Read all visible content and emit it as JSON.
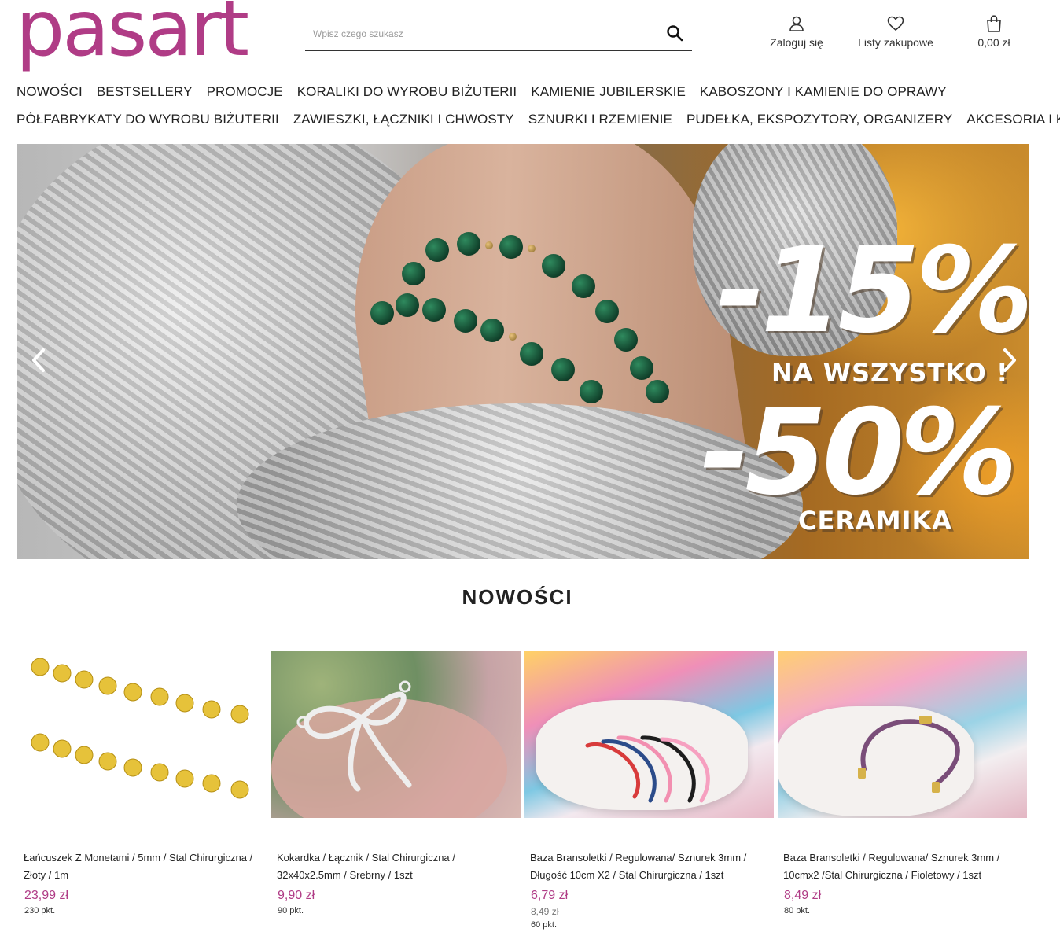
{
  "brand": {
    "logo_text": "pasart",
    "color": "#b03c86"
  },
  "search": {
    "placeholder": "Wpisz czego szukasz",
    "icon": "search-icon"
  },
  "header_actions": {
    "login": {
      "label": "Zaloguj się",
      "icon": "user-icon"
    },
    "lists": {
      "label": "Listy zakupowe",
      "icon": "heart-icon"
    },
    "cart": {
      "label": "0,00 zł",
      "icon": "shopping-bag-icon"
    }
  },
  "nav": {
    "row1": [
      "NOWOŚCI",
      "BESTSELLERY",
      "PROMOCJE",
      "KORALIKI DO WYROBU BIŻUTERII",
      "KAMIENIE JUBILERSKIE",
      "KABOSZONY I KAMIENIE DO OPRAWY"
    ],
    "row2": [
      "PÓŁFABRYKATY DO WYROBU BIŻUTERII",
      "ZAWIESZKI, ŁĄCZNIKI I CHWOSTY",
      "SZNURKI I RZEMIENIE",
      "PUDEŁKA, EKSPOZYTORY, ORGANIZERY",
      "AKCESORIA I KLEJE"
    ]
  },
  "hero": {
    "discount1": "-15%",
    "caption1": "NA WSZYSTKO !",
    "discount2": "-50%",
    "caption2": "CERAMIKA",
    "prev_icon": "chevron-left-icon",
    "next_icon": "chevron-right-icon"
  },
  "section": {
    "title": "NOWOŚCI"
  },
  "products": [
    {
      "name": "Łańcuszek Z Monetami / 5mm / Stal Chirurgiczna / Złoty / 1m",
      "price": "23,99 zł",
      "old_price": "",
      "points": "230 pkt."
    },
    {
      "name": "Kokardka / Łącznik / Stal Chirurgiczna / 32x40x2.5mm / Srebrny / 1szt",
      "price": "9,90 zł",
      "old_price": "",
      "points": "90 pkt."
    },
    {
      "name": "Baza Bransoletki / Regulowana/ Sznurek 3mm / Długość 10cm X2 / Stal Chirurgiczna / 1szt",
      "price": "6,79 zł",
      "old_price": "8,49 zł",
      "points": "60 pkt."
    },
    {
      "name": "Baza Bransoletki / Regulowana/ Sznurek 3mm / 10cmx2 /Stal Chirurgiczna / Fioletowy / 1szt",
      "price": "8,49 zł",
      "old_price": "",
      "points": "80 pkt."
    }
  ]
}
